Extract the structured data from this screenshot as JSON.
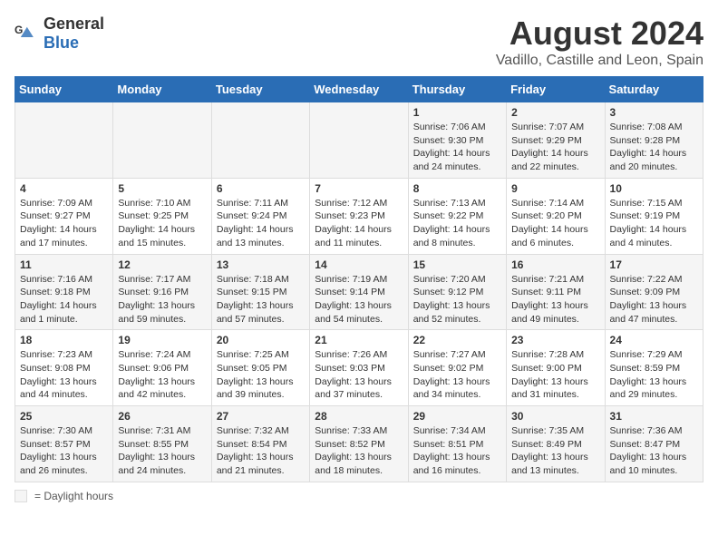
{
  "logo": {
    "general": "General",
    "blue": "Blue"
  },
  "title": "August 2024",
  "subtitle": "Vadillo, Castille and Leon, Spain",
  "days_of_week": [
    "Sunday",
    "Monday",
    "Tuesday",
    "Wednesday",
    "Thursday",
    "Friday",
    "Saturday"
  ],
  "weeks": [
    [
      {
        "day": "",
        "info": ""
      },
      {
        "day": "",
        "info": ""
      },
      {
        "day": "",
        "info": ""
      },
      {
        "day": "",
        "info": ""
      },
      {
        "day": "1",
        "info": "Sunrise: 7:06 AM\nSunset: 9:30 PM\nDaylight: 14 hours and 24 minutes."
      },
      {
        "day": "2",
        "info": "Sunrise: 7:07 AM\nSunset: 9:29 PM\nDaylight: 14 hours and 22 minutes."
      },
      {
        "day": "3",
        "info": "Sunrise: 7:08 AM\nSunset: 9:28 PM\nDaylight: 14 hours and 20 minutes."
      }
    ],
    [
      {
        "day": "4",
        "info": "Sunrise: 7:09 AM\nSunset: 9:27 PM\nDaylight: 14 hours and 17 minutes."
      },
      {
        "day": "5",
        "info": "Sunrise: 7:10 AM\nSunset: 9:25 PM\nDaylight: 14 hours and 15 minutes."
      },
      {
        "day": "6",
        "info": "Sunrise: 7:11 AM\nSunset: 9:24 PM\nDaylight: 14 hours and 13 minutes."
      },
      {
        "day": "7",
        "info": "Sunrise: 7:12 AM\nSunset: 9:23 PM\nDaylight: 14 hours and 11 minutes."
      },
      {
        "day": "8",
        "info": "Sunrise: 7:13 AM\nSunset: 9:22 PM\nDaylight: 14 hours and 8 minutes."
      },
      {
        "day": "9",
        "info": "Sunrise: 7:14 AM\nSunset: 9:20 PM\nDaylight: 14 hours and 6 minutes."
      },
      {
        "day": "10",
        "info": "Sunrise: 7:15 AM\nSunset: 9:19 PM\nDaylight: 14 hours and 4 minutes."
      }
    ],
    [
      {
        "day": "11",
        "info": "Sunrise: 7:16 AM\nSunset: 9:18 PM\nDaylight: 14 hours and 1 minute."
      },
      {
        "day": "12",
        "info": "Sunrise: 7:17 AM\nSunset: 9:16 PM\nDaylight: 13 hours and 59 minutes."
      },
      {
        "day": "13",
        "info": "Sunrise: 7:18 AM\nSunset: 9:15 PM\nDaylight: 13 hours and 57 minutes."
      },
      {
        "day": "14",
        "info": "Sunrise: 7:19 AM\nSunset: 9:14 PM\nDaylight: 13 hours and 54 minutes."
      },
      {
        "day": "15",
        "info": "Sunrise: 7:20 AM\nSunset: 9:12 PM\nDaylight: 13 hours and 52 minutes."
      },
      {
        "day": "16",
        "info": "Sunrise: 7:21 AM\nSunset: 9:11 PM\nDaylight: 13 hours and 49 minutes."
      },
      {
        "day": "17",
        "info": "Sunrise: 7:22 AM\nSunset: 9:09 PM\nDaylight: 13 hours and 47 minutes."
      }
    ],
    [
      {
        "day": "18",
        "info": "Sunrise: 7:23 AM\nSunset: 9:08 PM\nDaylight: 13 hours and 44 minutes."
      },
      {
        "day": "19",
        "info": "Sunrise: 7:24 AM\nSunset: 9:06 PM\nDaylight: 13 hours and 42 minutes."
      },
      {
        "day": "20",
        "info": "Sunrise: 7:25 AM\nSunset: 9:05 PM\nDaylight: 13 hours and 39 minutes."
      },
      {
        "day": "21",
        "info": "Sunrise: 7:26 AM\nSunset: 9:03 PM\nDaylight: 13 hours and 37 minutes."
      },
      {
        "day": "22",
        "info": "Sunrise: 7:27 AM\nSunset: 9:02 PM\nDaylight: 13 hours and 34 minutes."
      },
      {
        "day": "23",
        "info": "Sunrise: 7:28 AM\nSunset: 9:00 PM\nDaylight: 13 hours and 31 minutes."
      },
      {
        "day": "24",
        "info": "Sunrise: 7:29 AM\nSunset: 8:59 PM\nDaylight: 13 hours and 29 minutes."
      }
    ],
    [
      {
        "day": "25",
        "info": "Sunrise: 7:30 AM\nSunset: 8:57 PM\nDaylight: 13 hours and 26 minutes."
      },
      {
        "day": "26",
        "info": "Sunrise: 7:31 AM\nSunset: 8:55 PM\nDaylight: 13 hours and 24 minutes."
      },
      {
        "day": "27",
        "info": "Sunrise: 7:32 AM\nSunset: 8:54 PM\nDaylight: 13 hours and 21 minutes."
      },
      {
        "day": "28",
        "info": "Sunrise: 7:33 AM\nSunset: 8:52 PM\nDaylight: 13 hours and 18 minutes."
      },
      {
        "day": "29",
        "info": "Sunrise: 7:34 AM\nSunset: 8:51 PM\nDaylight: 13 hours and 16 minutes."
      },
      {
        "day": "30",
        "info": "Sunrise: 7:35 AM\nSunset: 8:49 PM\nDaylight: 13 hours and 13 minutes."
      },
      {
        "day": "31",
        "info": "Sunrise: 7:36 AM\nSunset: 8:47 PM\nDaylight: 13 hours and 10 minutes."
      }
    ]
  ],
  "legend": {
    "box_label": "= Daylight hours"
  }
}
